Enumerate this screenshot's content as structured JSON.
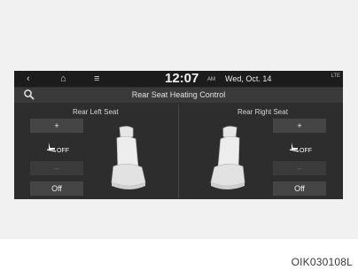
{
  "status_bar": {
    "back_icon": "‹",
    "home_icon": "⌂",
    "menu_icon": "≡",
    "time": "12:07",
    "ampm": "AM",
    "date": "Wed, Oct. 14",
    "signal_icon": "LTE"
  },
  "title_bar": {
    "title": "Rear Seat Heating Control"
  },
  "left": {
    "label": "Rear Left Seat",
    "plus": "+",
    "heat_level": "OFF",
    "minus": "–",
    "off": "Off"
  },
  "right": {
    "label": "Rear Right Seat",
    "plus": "+",
    "heat_level": "OFF",
    "minus": "–",
    "off": "Off"
  },
  "figure_code": "OIK030108L",
  "colors": {
    "screen_bg": "#2d2d2d",
    "button_bg": "#454545",
    "seat": "#e8e8e8"
  }
}
